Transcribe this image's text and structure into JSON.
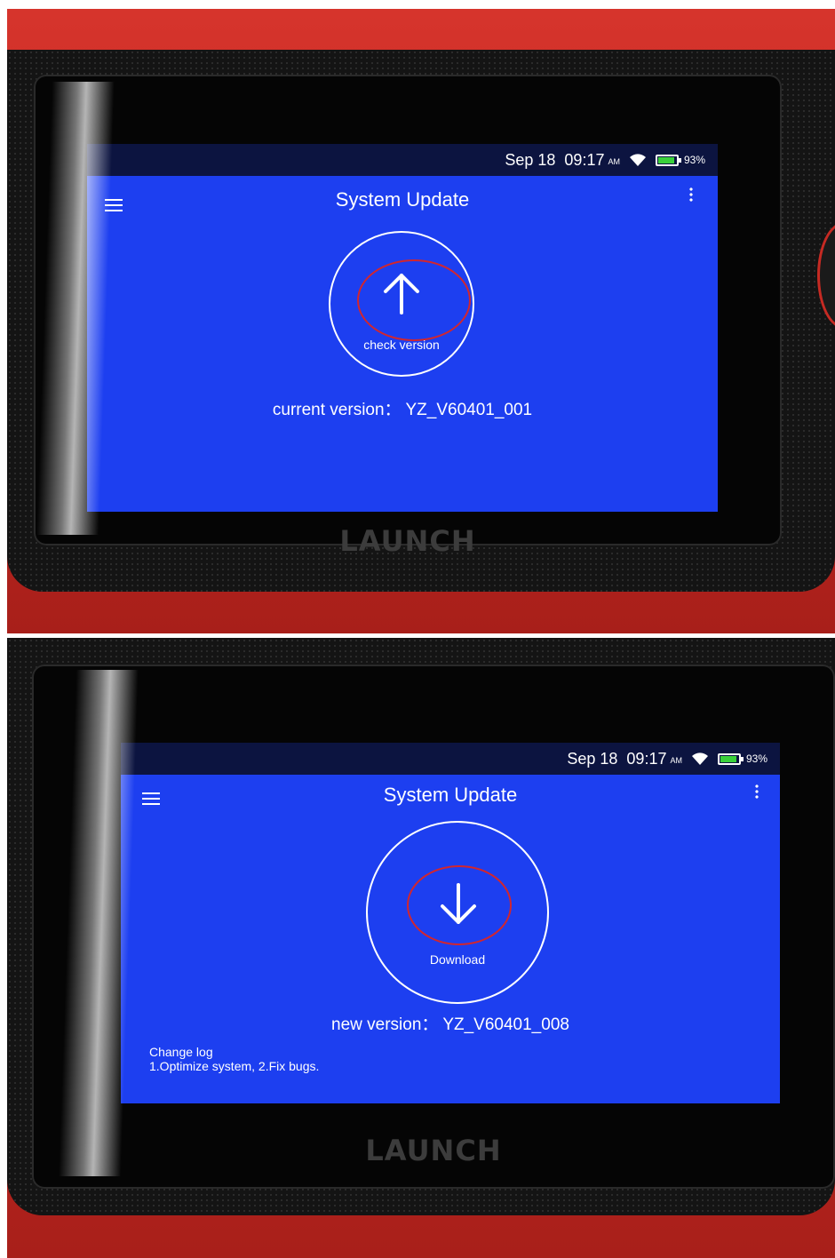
{
  "colors": {
    "screen_blue": "#1d3ff0",
    "status_bar": "#0c1440",
    "device_red": "#c62a23",
    "highlight_ellipse": "#d2262e",
    "battery_green": "#3ad13a"
  },
  "device": {
    "brand": "LAUNCH"
  },
  "panel_top": {
    "status_bar": {
      "date": "Sep 18",
      "time": "09:17",
      "ampm": "AM",
      "battery": "93%",
      "battery_level": 0.93
    },
    "title": "System Update",
    "action_icon": "arrow-up-icon",
    "button_label": "check version",
    "version_line": "current version： YZ_V60401_001"
  },
  "panel_bottom": {
    "status_bar": {
      "date": "Sep 18",
      "time": "09:17",
      "ampm": "AM",
      "battery": "93%",
      "battery_level": 0.93
    },
    "title": "System Update",
    "action_icon": "arrow-down-icon",
    "button_label": "Download",
    "version_line": "new version： YZ_V60401_008",
    "change_log": {
      "heading": "Change log",
      "text": "1.Optimize system, 2.Fix bugs."
    }
  }
}
